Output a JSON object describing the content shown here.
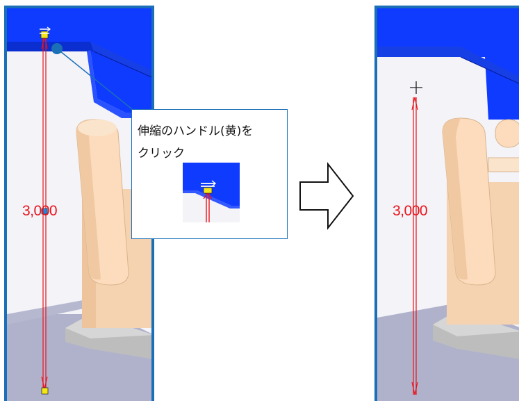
{
  "left_view": {
    "dimension_value": "3,000"
  },
  "callout": {
    "line1": "伸縮のハンドル(黄)を",
    "line2": "クリック"
  },
  "right_view": {
    "dimension_value": "3,000"
  },
  "colors": {
    "frame_border": "#1a6fb7",
    "beam_blue": "#0f3bff",
    "robot_body": "#fcdcbc",
    "dimension_red": "#e8141c",
    "handle_yellow": "#f5e617"
  },
  "icons": {
    "step_arrow": "arrow-right-outline-icon",
    "cursor": "crosshair-cursor-icon",
    "handle": "stretch-handle-icon"
  }
}
